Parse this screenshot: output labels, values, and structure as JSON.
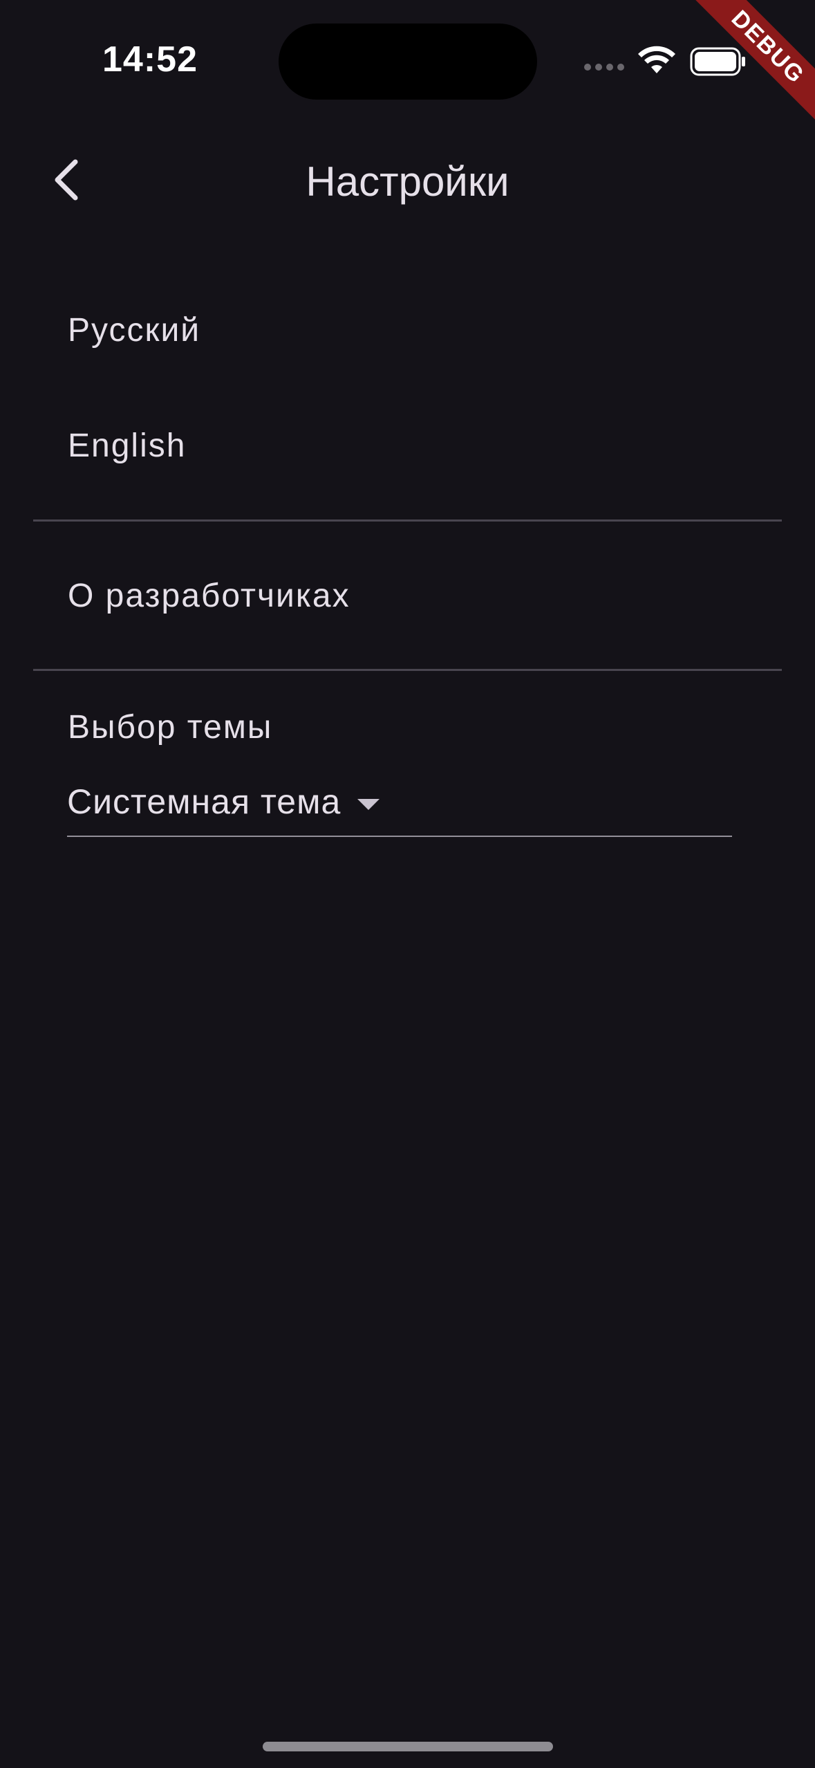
{
  "status_bar": {
    "time": "14:52"
  },
  "debug_banner": "DEBUG",
  "app_bar": {
    "title": "Настройки",
    "back_icon": "chevron-left-icon"
  },
  "languages": [
    {
      "label": "Русский"
    },
    {
      "label": "English"
    }
  ],
  "about": {
    "label": "О разработчиках"
  },
  "theme": {
    "label": "Выбор темы",
    "selected": "Системная тема"
  },
  "colors": {
    "background": "#141218",
    "text": "#e6e0e9",
    "divider": "#49454f",
    "debug_ribbon": "#8b1a1a"
  }
}
